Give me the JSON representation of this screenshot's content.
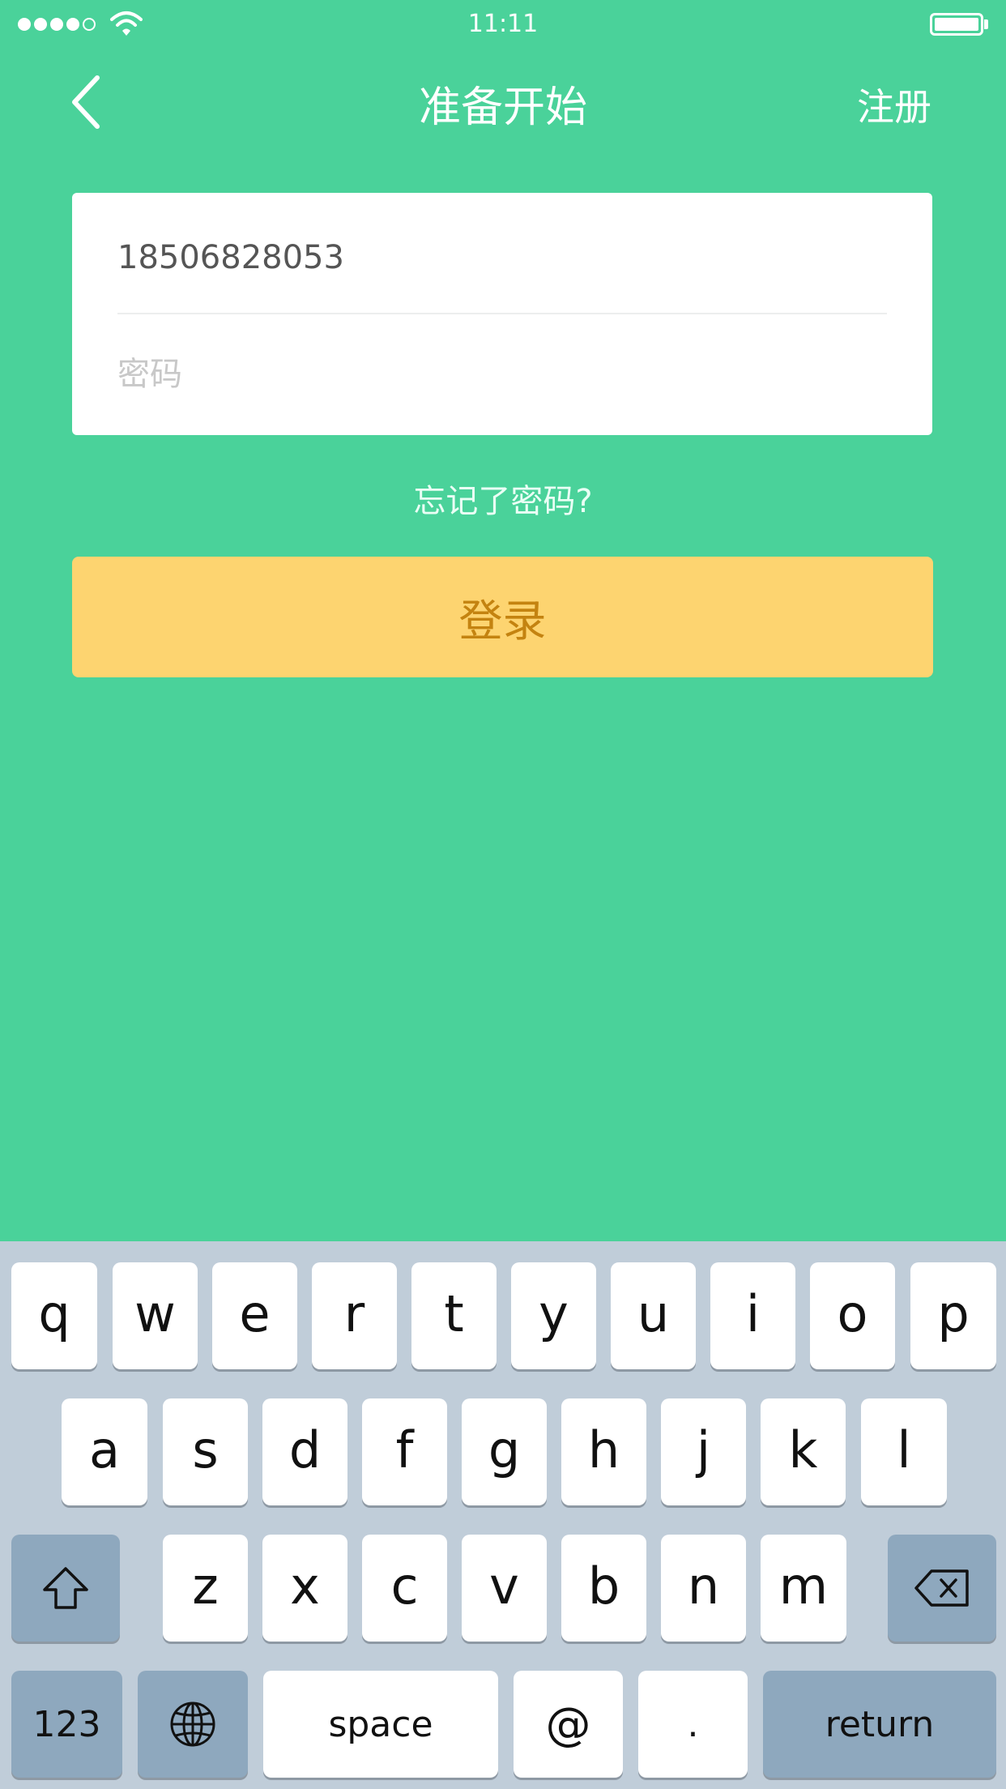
{
  "status_bar": {
    "time": "11:11",
    "signal_bars": 5,
    "signal_filled": 4,
    "battery_level": 1.0
  },
  "nav": {
    "title": "准备开始",
    "right_action": "注册",
    "back_icon": "chevron-left-icon"
  },
  "form": {
    "phone_value": "18506828053",
    "password_placeholder": "密码"
  },
  "forgot_password": "忘记了密码?",
  "login_button": "登录",
  "colors": {
    "background": "#4ad29a",
    "login_button": "#fdd470",
    "login_text": "#c48310",
    "keyboard": "#c0cdd9"
  },
  "keyboard": {
    "row1": [
      "q",
      "w",
      "e",
      "r",
      "t",
      "y",
      "u",
      "i",
      "o",
      "p"
    ],
    "row2": [
      "a",
      "s",
      "d",
      "f",
      "g",
      "h",
      "j",
      "k",
      "l"
    ],
    "row3": [
      "z",
      "x",
      "c",
      "v",
      "b",
      "n",
      "m"
    ],
    "numbers": "123",
    "space": "space",
    "at": "@",
    "period": ".",
    "return": "return",
    "shift_icon": "shift-icon",
    "delete_icon": "backspace-icon",
    "globe_icon": "globe-icon"
  }
}
